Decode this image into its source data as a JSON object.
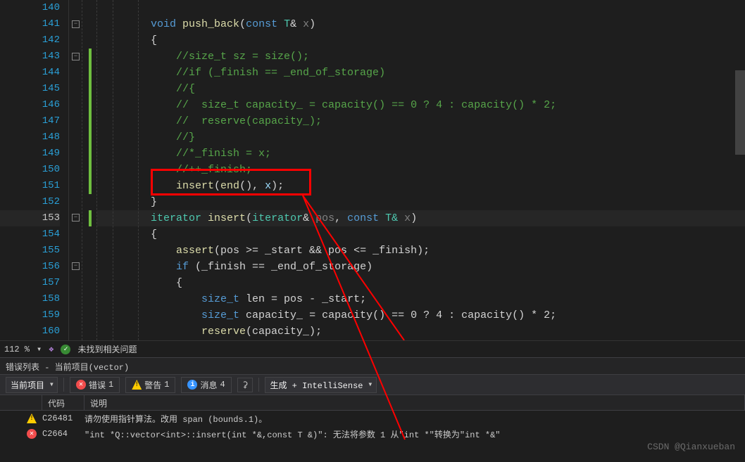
{
  "lines": {
    "start": 140,
    "highlighted": 153
  },
  "code": {
    "l140": "",
    "l141_void": "void",
    "l141_fn": "push_back",
    "l141_sig": "(const T& x)",
    "l142": "{",
    "l143": "//size_t sz = size();",
    "l144": "//if (_finish == _end_of_storage)",
    "l145": "//{",
    "l146": "//  size_t capacity_ = capacity() == 0 ? 4 : capacity() * 2;",
    "l147": "//  reserve(capacity_);",
    "l148": "//}",
    "l149": "//*_finish = x;",
    "l150": "//++_finish;",
    "l151_insert": "insert",
    "l151_args": "(end(), x);",
    "l152": "}",
    "l153_iter": "iterator",
    "l153_insert": "insert",
    "l153_sig_open": "(",
    "l153_iter2": "iterator",
    "l153_amp": "& ",
    "l153_pos": "pos",
    "l153_comma": ", ",
    "l153_const": "const",
    "l153_T": " T& ",
    "l153_x": "x",
    "l153_close": ")",
    "l154": "{",
    "l155_assert": "assert",
    "l155_body": "(pos >= _start && pos <= _finish);",
    "l156_if": "if",
    "l156_body": " (_finish == _end_of_storage)",
    "l157": "{",
    "l158_st": "size_t",
    "l158_body": " len = pos - _start;",
    "l159_st": "size_t",
    "l159_body": " capacity_ = capacity() == 0 ? 4 : capacity() * 2;",
    "l160_fn": "reserve",
    "l160_body": "(capacity_);"
  },
  "status": {
    "zoom": "112 %",
    "issues": "未找到相关问题"
  },
  "panel": {
    "title": "错误列表 - 当前项目(vector)",
    "scope": "当前项目",
    "errors_label": "错误",
    "errors_count": "1",
    "warnings_label": "警告",
    "warnings_count": "1",
    "messages_label": "消息",
    "messages_count": "4",
    "build_label": "生成 + IntelliSense",
    "col_code": "代码",
    "col_desc": "说明"
  },
  "errors": [
    {
      "type": "warn",
      "code": "C26481",
      "desc": "请勿使用指针算法。改用 span (bounds.1)。"
    },
    {
      "type": "err",
      "code": "C2664",
      "desc": "\"int *Q::vector<int>::insert(int *&,const T &)\": 无法将参数 1 从\"int *\"转换为\"int *&\""
    }
  ],
  "watermark": "CSDN @Qianxueban"
}
